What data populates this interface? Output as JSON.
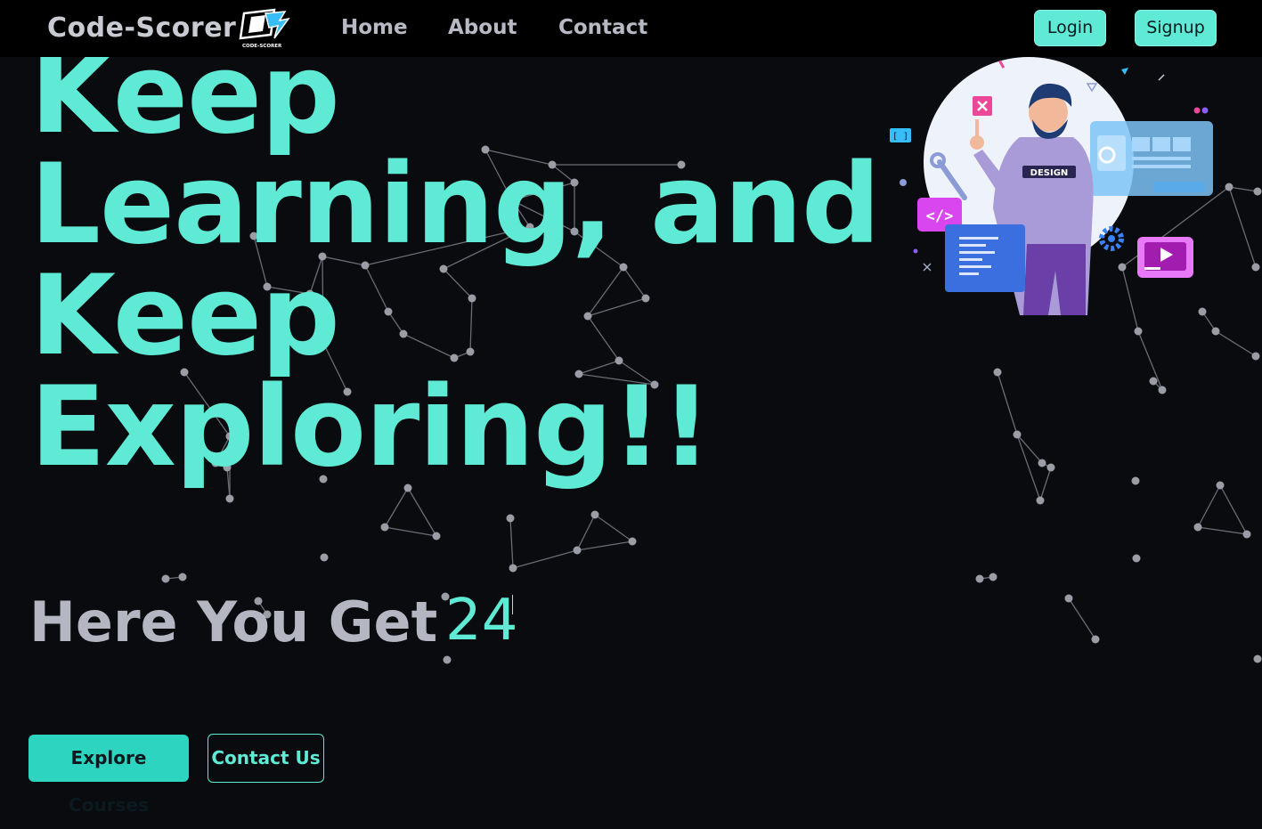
{
  "nav": {
    "brand": "Code-Scorer",
    "logo_caption": "CODE-SCORER",
    "links": [
      "Home",
      "About",
      "Contact"
    ],
    "login_label": "Login",
    "signup_label": "Signup"
  },
  "hero": {
    "headline_lines": [
      "Keep",
      "Learning, and",
      "Keep",
      "Exploring!!"
    ],
    "subheading_static": "Here You Get",
    "subheading_typed": "24",
    "explore_label": "Explore Courses",
    "contact_label": "Contact Us",
    "illustration_badge": "DESIGN"
  },
  "colors": {
    "accent": "#5eead4",
    "accent_dark": "#2dd4bf",
    "background": "#0a0b0e",
    "navbar": "#000000",
    "muted_text": "#b4b6c2"
  },
  "icons": [
    "code-scorer-logo-icon",
    "close-icon",
    "code-tag-icon",
    "wrench-icon",
    "gear-icon",
    "play-icon",
    "brackets-icon"
  ]
}
